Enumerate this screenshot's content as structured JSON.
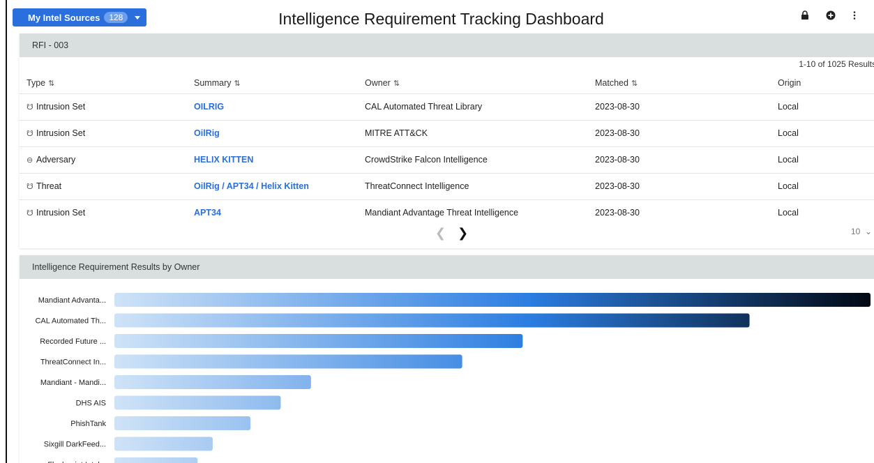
{
  "header": {
    "sources_label": "My Intel Sources",
    "sources_count": "128",
    "title": "Intelligence Requirement Tracking Dashboard",
    "icons": [
      "lock-icon",
      "plus-circle-icon",
      "more-vertical-icon"
    ]
  },
  "rfi_panel": {
    "title": "RFI - 003",
    "results_count": "1-10 of 1025 Results",
    "columns": {
      "type": "Type",
      "summary": "Summary",
      "owner": "Owner",
      "matched": "Matched",
      "origin": "Origin"
    },
    "rows": [
      {
        "type": "Intrusion Set",
        "icon": "intrusion-set-icon",
        "summary": "OILRIG",
        "owner": "CAL Automated Threat Library",
        "matched": "2023-08-30",
        "origin": "Local"
      },
      {
        "type": "Intrusion Set",
        "icon": "intrusion-set-icon",
        "summary": "OilRig",
        "owner": "MITRE ATT&CK",
        "matched": "2023-08-30",
        "origin": "Local"
      },
      {
        "type": "Adversary",
        "icon": "adversary-icon",
        "summary": "HELIX KITTEN",
        "owner": "CrowdStrike Falcon Intelligence",
        "matched": "2023-08-30",
        "origin": "Local"
      },
      {
        "type": "Threat",
        "icon": "threat-icon",
        "summary": "OilRig / APT34 / Helix Kitten",
        "owner": "ThreatConnect Intelligence",
        "matched": "2023-08-30",
        "origin": "Local"
      },
      {
        "type": "Intrusion Set",
        "icon": "intrusion-set-icon",
        "summary": "APT34",
        "owner": "Mandiant Advantage Threat Intelligence",
        "matched": "2023-08-30",
        "origin": "Local"
      }
    ],
    "page_size": "10"
  },
  "owner_panel": {
    "title": "Intelligence Requirement Results by Owner"
  },
  "chart_data": {
    "type": "bar",
    "orientation": "horizontal",
    "title": "Intelligence Requirement Results by Owner",
    "categories": [
      "Mandiant Advanta...",
      "CAL Automated Th...",
      "Recorded Future ...",
      "ThreatConnect In...",
      "Mandiant - Mandi...",
      "DHS AIS",
      "PhishTank",
      "Sixgill DarkFeed...",
      "Flashpoint Intel..."
    ],
    "values": [
      100,
      84,
      54,
      46,
      26,
      22,
      18,
      13,
      11
    ],
    "xlim": [
      0,
      100
    ],
    "grid": false,
    "colors": {
      "low": "#cfe3f7",
      "mid": "#2b7de1",
      "high": "#020812"
    }
  }
}
